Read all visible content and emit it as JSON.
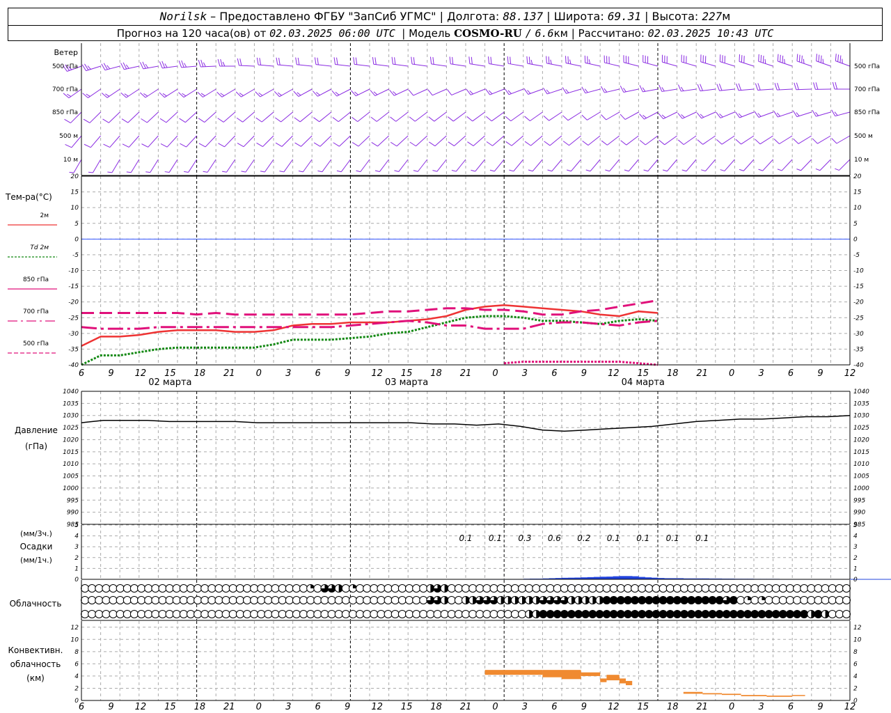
{
  "header": {
    "station": "Norilsk",
    "dash": "–",
    "provider": "Предоставлено ФГБУ \"ЗапСиб УГМС\"",
    "lon_label": "Долгота:",
    "lon_value": "88.137",
    "lat_label": "Широта:",
    "lat_value": "69.31",
    "alt_label": "Высота:",
    "alt_value": "227",
    "alt_unit": "м",
    "forecast_label": "Прогноз на 120 часа(ов) от",
    "forecast_start": "02.03.2025 06:00 UTC",
    "model_label": "Модель",
    "model_name": "COSMO-RU",
    "model_slash": "/",
    "model_res": "6.6",
    "model_res_unit": "км",
    "calc_label": "Рассчитано:",
    "calc_time": "02.03.2025 10:43 UTC"
  },
  "colors": {
    "wind": "#8a2be2",
    "t2m": "#ee3333",
    "td2m": "#118811",
    "t850": "#e0107a",
    "t700": "#e0107a",
    "t500": "#e0107a",
    "zero_line": "#3355ff",
    "pressure": "#000000",
    "precip": "#2244dd",
    "conv": "#f08a30",
    "grid": "#aaaaaa"
  },
  "axis": {
    "hour_labels": [
      "6",
      "9",
      "12",
      "15",
      "18",
      "21",
      "0",
      "3",
      "6",
      "9",
      "12",
      "15",
      "18",
      "21",
      "0",
      "3",
      "6",
      "9",
      "12",
      "15",
      "18",
      "21",
      "0",
      "3",
      "6",
      "9",
      "12"
    ],
    "day_labels": [
      {
        "text": "02 марта",
        "step": 3
      },
      {
        "text": "03 марта",
        "step": 11
      },
      {
        "text": "04 марта",
        "step": 19
      }
    ],
    "midnight_steps": [
      6,
      14,
      22,
      30
    ]
  },
  "wind_panel": {
    "title": "Ветер",
    "levels_left": [
      "500 гПа",
      "700 гПа",
      "850 гПа",
      "500 м",
      "10  м"
    ],
    "levels_right": [
      "500 гПа",
      "700 гПа",
      "850 гПа",
      "500 м",
      "10  м"
    ]
  },
  "temp_panel": {
    "title": "Тем-ра(°C)",
    "legend": [
      {
        "label": "2м",
        "key": "t2m",
        "style": "solid"
      },
      {
        "label": "Td  2м",
        "key": "td2m",
        "style": "dotted"
      },
      {
        "label": "850 гПа",
        "key": "t850",
        "style": "solid-thin"
      },
      {
        "label": "700 гПа",
        "key": "t700",
        "style": "dashdot"
      },
      {
        "label": "500 гПа",
        "key": "t500",
        "style": "dashed-thin"
      }
    ],
    "ticks": [
      "20",
      "15",
      "10",
      "5",
      "0",
      "-5",
      "-10",
      "-15",
      "-20",
      "-25",
      "-30",
      "-35",
      "-40"
    ]
  },
  "pressure_panel": {
    "title_line1": "Давление",
    "title_line2": "(гПа)",
    "ticks": [
      "1040",
      "1035",
      "1030",
      "1025",
      "1020",
      "1015",
      "1010",
      "1005",
      "1000",
      "995",
      "990",
      "985"
    ]
  },
  "precip_panel": {
    "label_line1": "(мм/3ч.)",
    "label_line2": "Осадки",
    "label_line3": "(мм/1ч.)",
    "ticks": [
      "5",
      "4",
      "3",
      "2",
      "1",
      "0"
    ],
    "amount_labels": [
      {
        "text": "0.1",
        "step": 13
      },
      {
        "text": "0.1",
        "step": 14
      },
      {
        "text": "0.3",
        "step": 15
      },
      {
        "text": "0.6",
        "step": 16
      },
      {
        "text": "0.2",
        "step": 17
      },
      {
        "text": "0.1",
        "step": 18
      },
      {
        "text": "0.1",
        "step": 19
      },
      {
        "text": "0.1",
        "step": 20
      },
      {
        "text": "0.1",
        "step": 21
      }
    ]
  },
  "cloud_panel": {
    "title": "Облачность"
  },
  "conv_panel": {
    "title_line1": "Конвективн.",
    "title_line2": "облачность",
    "title_line3": "(км)",
    "ticks": [
      "12",
      "10",
      "8",
      "6",
      "4",
      "2",
      "0"
    ]
  },
  "chart_data": {
    "type": "line",
    "x_hours": [
      0,
      3,
      6,
      9,
      12,
      15,
      18,
      21,
      24,
      27,
      30,
      33,
      36,
      39,
      42,
      45,
      48,
      51,
      54,
      57,
      60,
      63,
      66,
      69,
      72,
      75,
      78,
      81,
      84,
      87,
      90,
      93,
      96,
      99,
      102,
      105,
      108,
      111,
      114,
      117,
      120
    ],
    "temperature": {
      "ylim": [
        -40,
        20
      ],
      "series": [
        {
          "key": "t2m",
          "name": "2м",
          "values": [
            -34,
            -31,
            -31,
            -30.5,
            -29.5,
            -29,
            -29,
            -29,
            -29.5,
            -29.5,
            -29,
            -27.5,
            -27,
            -27,
            -26.5,
            -26.5,
            -26.5,
            -26,
            -25.5,
            -24.5,
            -22.5,
            -21.5,
            -21,
            -21.5,
            -22,
            -22.5,
            -23,
            -24,
            -24.5,
            -23,
            -23.5
          ]
        },
        {
          "key": "td2m",
          "name": "Td  2м",
          "values": [
            -40,
            -37,
            -37,
            -36,
            -35,
            -34.5,
            -34.5,
            -34.5,
            -34.5,
            -34.5,
            -33.5,
            -32,
            -32,
            -32,
            -31.5,
            -31,
            -30,
            -29.5,
            -28,
            -26.5,
            -25,
            -24.5,
            -24.5,
            -25,
            -26,
            -26,
            -26.5,
            -27,
            -26,
            -25.5,
            -26
          ]
        },
        {
          "key": "t850",
          "name": "850 гПа",
          "values": [
            -28,
            -28.5,
            -28.5,
            -28.5,
            -28,
            -28,
            -28,
            -28,
            -28,
            -28,
            -28,
            -28,
            -28,
            -28,
            -27.5,
            -27,
            -26.5,
            -26,
            -26.5,
            -27.5,
            -27.5,
            -28.5,
            -28.5,
            -28.5,
            -27,
            -26.5,
            -26.5,
            -27,
            -27.5,
            -26.5,
            -26
          ]
        },
        {
          "key": "t700",
          "name": "700 гПа",
          "values": [
            -23.5,
            -23.5,
            -23.5,
            -23.5,
            -23.5,
            -23.5,
            -24,
            -23.5,
            -24,
            -24,
            -24,
            -24,
            -24,
            -24,
            -24,
            -23.5,
            -23,
            -23,
            -22.5,
            -22,
            -22,
            -22.5,
            -22.5,
            -23,
            -24,
            -24,
            -23,
            -22.5,
            -21.5,
            -20.5,
            -19.5
          ]
        },
        {
          "key": "t500",
          "name": "500 гПа",
          "x_start_step": 22,
          "x_end_step": 30,
          "values": [
            -39.5,
            -39,
            -39,
            -39,
            -39,
            -39,
            -39,
            -39.5,
            -40
          ]
        }
      ]
    },
    "pressure": {
      "ylim": [
        985,
        1040
      ],
      "values": [
        1027,
        1028,
        1028,
        1028,
        1027.5,
        1027.5,
        1027.5,
        1027.5,
        1027,
        1027,
        1027,
        1027,
        1027,
        1027,
        1027,
        1027,
        1026.5,
        1026.5,
        1026,
        1026.5,
        1025.5,
        1024,
        1023.5,
        1024,
        1024.5,
        1025,
        1025.5,
        1026.5,
        1027.5,
        1028,
        1028.5,
        1028.5,
        1029,
        1029.5,
        1029.5,
        1030
      ]
    },
    "precipitation": {
      "ylim": [
        0,
        5
      ],
      "hourly_start": 63,
      "hourly_mm": [
        0.03,
        0.03,
        0.03,
        0.03,
        0.03,
        0.03,
        0.05,
        0.06,
        0.06,
        0.08,
        0.1,
        0.12,
        0.14,
        0.15,
        0.16,
        0.18,
        0.2,
        0.22,
        0.24,
        0.25,
        0.28,
        0.3,
        0.3,
        0.28,
        0.22,
        0.18,
        0.15,
        0.12,
        0.1,
        0.1,
        0.1,
        0.08,
        0.08,
        0.08,
        0.08,
        0.07,
        0.07,
        0.06,
        0.06,
        0.05,
        0.05,
        0.05,
        0.04,
        0.04,
        0.04,
        0.04,
        0.03,
        0.03,
        0.03,
        0.03,
        0.03,
        0.03,
        0.03,
        0.03,
        0.03,
        0.03,
        0.03,
        0.03,
        0.03,
        0.03,
        0.03,
        0.03,
        0.03,
        0.03
      ]
    },
    "cloud_cover": {
      "steps_per_row": 41,
      "levels": [
        "high",
        "middle",
        "low"
      ],
      "high": [
        0,
        0,
        0,
        0,
        0,
        0,
        0,
        0,
        0,
        0,
        0,
        0,
        0,
        0,
        0,
        0,
        0,
        0,
        0,
        0,
        0,
        0,
        0,
        0,
        0,
        0,
        0,
        0,
        0,
        0,
        0,
        0,
        0,
        0,
        0,
        0,
        0,
        0,
        0,
        0,
        0,
        0,
        0,
        0,
        0,
        0,
        0,
        0,
        0,
        0,
        0,
        0,
        0,
        0,
        0,
        0,
        0,
        0,
        0,
        0,
        0,
        0,
        0,
        0,
        0,
        0,
        0,
        0,
        0,
        0,
        0,
        0,
        0,
        0,
        0,
        0,
        0,
        0,
        0,
        0,
        0,
        0,
        0,
        0,
        0,
        0,
        0,
        0,
        0,
        0,
        0,
        0,
        0,
        0,
        0,
        0,
        0,
        0,
        0,
        0,
        0,
        0,
        0,
        0,
        0,
        0,
        0,
        0,
        0,
        0,
        0,
        0,
        0,
        0,
        0,
        0,
        0,
        0,
        0,
        0,
        0
      ],
      "high_hourly_overrides": [
        {
          "hour": 36,
          "v": 0.25
        },
        {
          "hour": 38,
          "v": 0.75
        },
        {
          "hour": 39,
          "v": 0.75
        },
        {
          "hour": 40,
          "v": 0.5
        },
        {
          "hour": 42,
          "v": 0.25
        },
        {
          "hour": 54,
          "v": 0.5
        },
        {
          "hour": 55,
          "v": 0.75
        },
        {
          "hour": 56,
          "v": 0.75
        },
        {
          "hour": 57,
          "v": 0.5
        }
      ],
      "middle_hourly_overrides": [
        {
          "hour": 45,
          "v": 0.5
        },
        {
          "hour": 54,
          "v": 0.75
        },
        {
          "hour": 55,
          "v": 0.75
        },
        {
          "hour": 56,
          "v": 0.75
        },
        {
          "hour": 57,
          "v": 0.5
        },
        {
          "hour": 60,
          "v": 0.5
        },
        {
          "hour": 61,
          "v": 0.5
        },
        {
          "hour": 62,
          "v": 0.75
        },
        {
          "hour": 63,
          "v": 0.75
        },
        {
          "hour": 64,
          "v": 0.75
        },
        {
          "hour": 66,
          "v": 0.5
        },
        {
          "hour": 67,
          "v": 0.5
        },
        {
          "hour": 68,
          "v": 0.5
        },
        {
          "hour": 69,
          "v": 0.5
        },
        {
          "hour": 70,
          "v": 0.5
        },
        {
          "hour": 71,
          "v": 0.5
        },
        {
          "hour": 72,
          "v": 0.75
        },
        {
          "hour": 73,
          "v": 0.75
        },
        {
          "hour": 74,
          "v": 0.75
        },
        {
          "hour": 75,
          "v": 0.75
        },
        {
          "hour": 76,
          "v": 0.75
        },
        {
          "hour": 77,
          "v": 0.5
        },
        {
          "hour": 78,
          "v": 0.5
        },
        {
          "hour": 79,
          "v": 0.5
        },
        {
          "hour": 80,
          "v": 0.5
        },
        {
          "hour": 81,
          "v": 0.5
        },
        {
          "hour": 82,
          "v": 1
        },
        {
          "hour": 83,
          "v": 1
        },
        {
          "hour": 84,
          "v": 1
        },
        {
          "hour": 85,
          "v": 1
        },
        {
          "hour": 86,
          "v": 1
        },
        {
          "hour": 87,
          "v": 1
        },
        {
          "hour": 88,
          "v": 1
        },
        {
          "hour": 89,
          "v": 1
        },
        {
          "hour": 90,
          "v": 1
        },
        {
          "hour": 91,
          "v": 1
        },
        {
          "hour": 92,
          "v": 1
        },
        {
          "hour": 93,
          "v": 1
        },
        {
          "hour": 94,
          "v": 1
        },
        {
          "hour": 95,
          "v": 1
        },
        {
          "hour": 96,
          "v": 1
        },
        {
          "hour": 97,
          "v": 1
        },
        {
          "hour": 98,
          "v": 1
        },
        {
          "hour": 99,
          "v": 1
        },
        {
          "hour": 100,
          "v": 1
        },
        {
          "hour": 101,
          "v": 0.75
        },
        {
          "hour": 102,
          "v": 1
        },
        {
          "hour": 104,
          "v": 0.25
        },
        {
          "hour": 107,
          "v": 0.25
        }
      ],
      "low_hourly_overrides_from": {
        "start_hour": 72,
        "end_hour": 113,
        "v": 1
      },
      "low_extra": [
        {
          "hour": 70,
          "v": 0.5
        },
        {
          "hour": 71,
          "v": 0.5
        },
        {
          "hour": 114,
          "v": 0.5
        },
        {
          "hour": 115,
          "v": 0.25
        },
        {
          "hour": 116,
          "v": 1
        },
        {
          "hour": 117,
          "v": 0.5
        }
      ]
    },
    "convective_cloud": {
      "ylim": [
        0,
        13
      ],
      "segments": [
        {
          "h0": 63,
          "h1": 72,
          "bottom": 4.2,
          "top": 5.0
        },
        {
          "h0": 72,
          "h1": 75,
          "bottom": 3.8,
          "top": 5.0
        },
        {
          "h0": 75,
          "h1": 78,
          "bottom": 3.5,
          "top": 5.0
        },
        {
          "h0": 78,
          "h1": 81,
          "bottom": 4.0,
          "top": 4.6
        },
        {
          "h0": 81,
          "h1": 82,
          "bottom": 3.0,
          "top": 3.6
        },
        {
          "h0": 82,
          "h1": 84,
          "bottom": 3.3,
          "top": 4.2
        },
        {
          "h0": 84,
          "h1": 85,
          "bottom": 2.8,
          "top": 3.6
        },
        {
          "h0": 85,
          "h1": 86,
          "bottom": 2.5,
          "top": 3.2
        },
        {
          "h0": 94,
          "h1": 97,
          "bottom": 1.1,
          "top": 1.4
        },
        {
          "h0": 97,
          "h1": 100,
          "bottom": 1.0,
          "top": 1.2
        },
        {
          "h0": 100,
          "h1": 103,
          "bottom": 0.9,
          "top": 1.1
        },
        {
          "h0": 103,
          "h1": 107,
          "bottom": 0.7,
          "top": 0.9
        },
        {
          "h0": 107,
          "h1": 111,
          "bottom": 0.6,
          "top": 0.8
        },
        {
          "h0": 111,
          "h1": 113,
          "bottom": 0.8,
          "top": 0.9
        }
      ]
    },
    "wind": {
      "rows": [
        "500hPa",
        "700hPa",
        "850hPa",
        "500m",
        "10m"
      ],
      "step_hours": 1,
      "direction_deg": {
        "500hPa": [
          [
            0,
            250
          ],
          [
            30,
            275
          ],
          [
            72,
            280
          ],
          [
            90,
            285
          ],
          [
            120,
            290
          ]
        ],
        "700hPa": [
          [
            0,
            235
          ],
          [
            30,
            240
          ],
          [
            72,
            250
          ],
          [
            90,
            260
          ],
          [
            120,
            270
          ]
        ],
        "850hPa": [
          [
            0,
            225
          ],
          [
            30,
            230
          ],
          [
            72,
            235
          ],
          [
            96,
            245
          ],
          [
            120,
            255
          ]
        ],
        "500m": [
          [
            0,
            220
          ],
          [
            30,
            225
          ],
          [
            72,
            230
          ],
          [
            96,
            235
          ],
          [
            120,
            240
          ]
        ],
        "10m": [
          [
            0,
            210
          ],
          [
            30,
            215
          ],
          [
            72,
            220
          ],
          [
            96,
            220
          ],
          [
            120,
            225
          ]
        ]
      },
      "speed_ms": {
        "500hPa": [
          [
            0,
            25
          ],
          [
            30,
            22
          ],
          [
            60,
            18
          ],
          [
            84,
            28
          ],
          [
            120,
            35
          ]
        ],
        "700hPa": [
          [
            0,
            15
          ],
          [
            30,
            14
          ],
          [
            60,
            12
          ],
          [
            84,
            16
          ],
          [
            120,
            20
          ]
        ],
        "850hPa": [
          [
            0,
            12
          ],
          [
            30,
            10
          ],
          [
            60,
            10
          ],
          [
            84,
            12
          ],
          [
            120,
            15
          ]
        ],
        "500m": [
          [
            0,
            10
          ],
          [
            30,
            9
          ],
          [
            60,
            9
          ],
          [
            84,
            10
          ],
          [
            120,
            12
          ]
        ],
        "10m": [
          [
            0,
            6
          ],
          [
            30,
            5
          ],
          [
            60,
            5
          ],
          [
            84,
            6
          ],
          [
            120,
            7
          ]
        ]
      }
    }
  }
}
